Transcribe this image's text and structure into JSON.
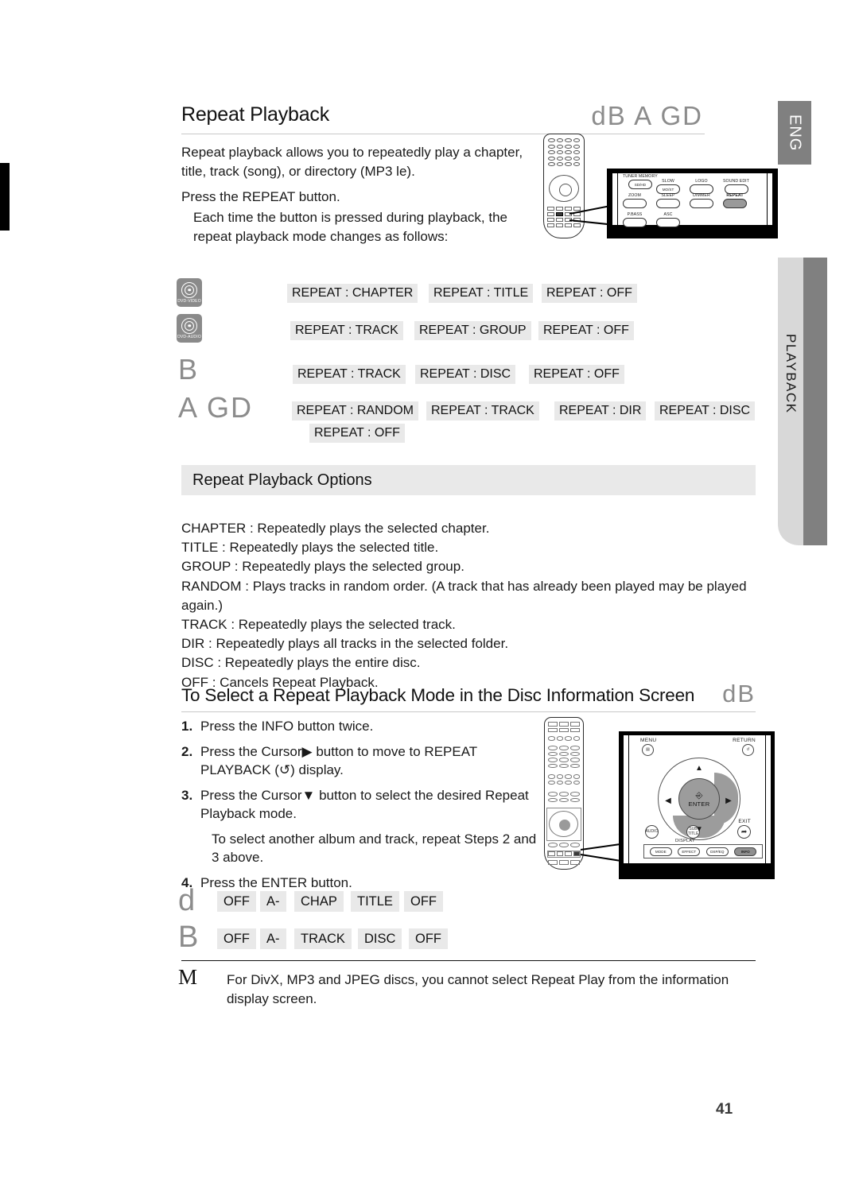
{
  "page": {
    "number": "41",
    "language_tab": "ENG",
    "section_tab": "PLAYBACK"
  },
  "section_repeat": {
    "title": "Repeat Playback",
    "disc_types": "dB  A GD",
    "intro": "Repeat playback allows you to repeatedly play a chapter, title, track (song), or directory (MP3  le).",
    "press": "Press the REPEAT button.",
    "each_time": "Each time the button is pressed during playback, the repeat playback mode changes as follows:"
  },
  "remote_top": {
    "buttons": [
      {
        "label": "TUNER MEMORY",
        "inner": "SD/HD",
        "highlighted": false
      },
      {
        "label": "SLOW",
        "inner": "MO/ST",
        "highlighted": false
      },
      {
        "label": "LOGO",
        "inner": "",
        "highlighted": false
      },
      {
        "label": "SOUND EDIT",
        "inner": "",
        "highlighted": false
      },
      {
        "label": "ZOOM",
        "inner": "",
        "highlighted": false
      },
      {
        "label": "SLEEP",
        "inner": "",
        "highlighted": false
      },
      {
        "label": "DIMMER",
        "inner": "",
        "highlighted": false
      },
      {
        "label": "REPEAT",
        "inner": "",
        "highlighted": true
      },
      {
        "label": "P.BASS",
        "inner": "",
        "highlighted": false
      },
      {
        "label": "ASC",
        "inner": "",
        "highlighted": false
      }
    ]
  },
  "mode_rows": [
    {
      "disc_icon": "DVD-VIDEO",
      "disc_glyph": "",
      "chips": [
        "REPEAT : CHAPTER",
        "REPEAT : TITLE",
        "REPEAT : OFF"
      ]
    },
    {
      "disc_icon": "DVD-AUDIO",
      "disc_glyph": "",
      "chips": [
        "REPEAT : TRACK",
        "REPEAT : GROUP",
        "REPEAT : OFF"
      ]
    },
    {
      "disc_icon": "",
      "disc_glyph": "B",
      "chips": [
        "REPEAT : TRACK",
        "REPEAT : DISC",
        "REPEAT : OFF"
      ]
    },
    {
      "disc_icon": "",
      "disc_glyph": "A GD",
      "chips": [
        "REPEAT : RANDOM",
        "REPEAT : TRACK",
        "REPEAT : DIR",
        "REPEAT : DISC"
      ],
      "chips_wrap": [
        "REPEAT : OFF"
      ]
    }
  ],
  "options": {
    "band_title": "Repeat Playback Options",
    "lines": [
      "CHAPTER : Repeatedly plays the selected chapter.",
      "TITLE : Repeatedly plays the selected title.",
      "GROUP : Repeatedly plays the selected group.",
      "RANDOM : Plays tracks in random order. (A track that has already been played may be played again.)",
      "TRACK : Repeatedly plays the selected track.",
      "DIR : Repeatedly plays all tracks in the selected folder.",
      "DISC : Repeatedly plays the entire disc.",
      "OFF : Cancels Repeat Playback."
    ]
  },
  "section_select": {
    "title": "To Select a Repeat Playback Mode in the Disc Information Screen",
    "disc_types": "dB",
    "steps": [
      {
        "num": "1.",
        "text": "Press the INFO button twice."
      },
      {
        "num": "2.",
        "text": "Press the Cursor▶ button to move to REPEAT PLAYBACK (↺) display."
      },
      {
        "num": "3.",
        "text": "Press the Cursor▼ button to select the desired Repeat Playback mode."
      }
    ],
    "sub_note": "To select another album and track, repeat Steps 2 and 3 above.",
    "step4": {
      "num": "4.",
      "text": "Press the ENTER button."
    }
  },
  "remote_bottom": {
    "labels": {
      "menu": "MENU",
      "return": "RETURN",
      "enter": "ENTER",
      "exit": "EXIT"
    },
    "round_buttons": [
      {
        "label": "AUDIO",
        "highlighted": false
      },
      {
        "label": "SUB TITLE",
        "highlighted": false
      }
    ],
    "strip_label": "DISPLAY",
    "strip_buttons": [
      {
        "label": "MODE",
        "highlighted": false
      },
      {
        "label": "EFFECT",
        "highlighted": false
      },
      {
        "label": "DSP/EQ",
        "highlighted": false
      },
      {
        "label": "INFO",
        "highlighted": true
      }
    ],
    "dpad_arrows": {
      "up": "▲",
      "down": "▼",
      "left": "◀",
      "right": "▶"
    }
  },
  "info_rows": [
    {
      "disc_glyph": "d",
      "chips": [
        "OFF",
        "A-",
        "CHAP",
        "TITLE",
        "OFF"
      ]
    },
    {
      "disc_glyph": "B",
      "chips": [
        "OFF",
        "A-",
        "TRACK",
        "DISC",
        "OFF"
      ]
    }
  ],
  "note": {
    "marker": "M",
    "text": "For DivX, MP3 and JPEG discs, you cannot select Repeat Play from the information display screen."
  }
}
